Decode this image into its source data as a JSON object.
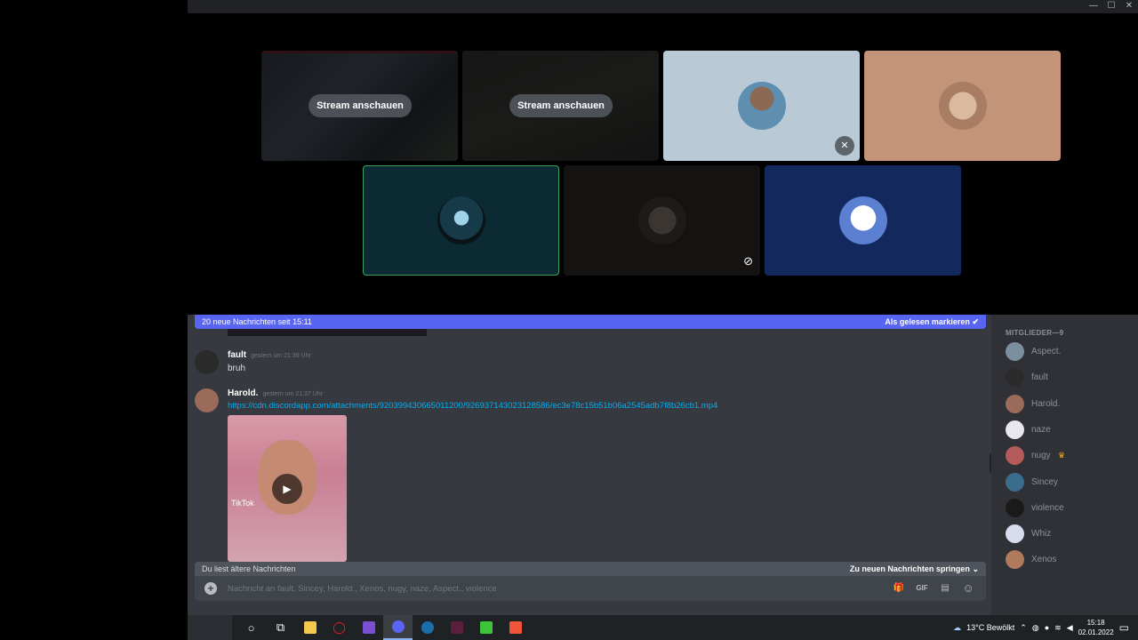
{
  "window": {
    "controls": [
      "—",
      "☐",
      "✕"
    ]
  },
  "call": {
    "stream_button_label": "Stream anschauen",
    "tiles_row1": [
      {
        "kind": "stream",
        "name": "tile-stream-1"
      },
      {
        "kind": "stream",
        "name": "tile-stream-2"
      },
      {
        "kind": "user",
        "bg": "#b9cad6",
        "muted": true
      },
      {
        "kind": "user",
        "bg": "#c49478",
        "muted": false
      }
    ],
    "tiles_row2": [
      {
        "kind": "user",
        "bg": "#0b2a33",
        "speaking": true
      },
      {
        "kind": "user",
        "bg": "#151311",
        "muted": true
      },
      {
        "kind": "user",
        "bg": "#13285c"
      }
    ]
  },
  "chat": {
    "new_messages_banner": "20 neue Nachrichten seit 15:11",
    "mark_read": "Als gelesen markieren",
    "messages": [
      {
        "author": "fault",
        "timestamp": "gestern um 21:36 Uhr",
        "text": "bruh"
      },
      {
        "author": "Harold.",
        "timestamp": "gestern um 21:37 Uhr",
        "link": "https://cdn.discordapp.com/attachments/920399430665011200/926937143023128586/ec3e78c15b51b06a2545adb7f8b26cb1.mp4"
      }
    ],
    "video_watermark": "TikTok",
    "older_banner": "Du liest ältere Nachrichten",
    "jump_label": "Zu neuen Nachrichten springen",
    "composer_placeholder": "Nachricht an fault, Sincey, Harold., Xenos, nugy, naze, Aspect., violence",
    "composer_tools": [
      "gift-icon",
      "gif-button",
      "sticker-icon",
      "emoji-icon"
    ],
    "composer_tool_labels": [
      "🎁",
      "GIF",
      "▤",
      "☺"
    ]
  },
  "members": {
    "header": "MITGLIEDER—9",
    "list": [
      {
        "name": "Aspect.",
        "color": "#7b8fa0"
      },
      {
        "name": "fault",
        "color": "#2b2b2b"
      },
      {
        "name": "Harold.",
        "color": "#9a6a5a"
      },
      {
        "name": "naze",
        "color": "#e8e6ee"
      },
      {
        "name": "nugy",
        "color": "#b45a5a",
        "owner": true
      },
      {
        "name": "Sincey",
        "color": "#3a6c8e"
      },
      {
        "name": "violence",
        "color": "#1a1a1a"
      },
      {
        "name": "Whiz",
        "color": "#d8dcef"
      },
      {
        "name": "Xenos",
        "color": "#b07a5c"
      }
    ]
  },
  "taskbar": {
    "weather": "13°C Bewölkt",
    "time": "15:18",
    "date": "02.01.2022"
  }
}
